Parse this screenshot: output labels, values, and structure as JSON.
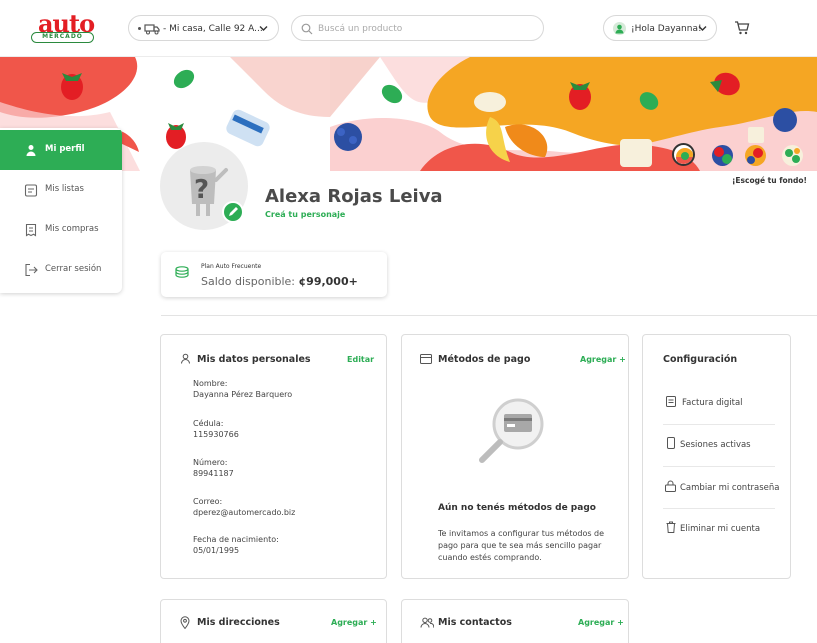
{
  "header": {
    "logo": {
      "top": "auto",
      "bottom": "MERCADO"
    },
    "address": "- Mi casa, Calle 92 A...",
    "search_placeholder": "Buscá un producto",
    "greeting": "¡Hola Dayanna!"
  },
  "sidebar": {
    "items": [
      {
        "label": "Mi perfil",
        "icon": "person-icon",
        "active": true
      },
      {
        "label": "Mis listas",
        "icon": "list-icon",
        "active": false
      },
      {
        "label": "Mis compras",
        "icon": "receipt-icon",
        "active": false
      },
      {
        "label": "Cerrar sesión",
        "icon": "logout-icon",
        "active": false
      }
    ]
  },
  "profile": {
    "name": "Alexa Rojas Leiva",
    "character_link": "Creá tu personaje",
    "background_pick": "¡Escogé tu fondo!"
  },
  "plan": {
    "title": "Plan Auto Frecuente",
    "balance_label": "Saldo disponible:",
    "balance_value": "¢99,000+"
  },
  "personal_data": {
    "title": "Mis datos personales",
    "edit": "Editar",
    "fields": [
      {
        "label": "Nombre:",
        "value": "Dayanna Pérez Barquero"
      },
      {
        "label": "Cédula:",
        "value": "115930766"
      },
      {
        "label": "Número:",
        "value": "89941187"
      },
      {
        "label": "Correo:",
        "value": "dperez@automercado.biz"
      },
      {
        "label": "Fecha de nacimiento:",
        "value": "05/01/1995"
      }
    ]
  },
  "payment": {
    "title": "Métodos de pago",
    "add": "Agregar +",
    "empty_title": "Aún no tenés métodos de pago",
    "empty_text": [
      "Te invitamos a configurar tus métodos de",
      "pago para que te sea más sencillo pagar",
      "cuando estés comprando."
    ]
  },
  "config": {
    "title": "Configuración",
    "items": [
      {
        "label": "Factura digital",
        "icon": "invoice-icon"
      },
      {
        "label": "Sesiones activas",
        "icon": "phone-icon"
      },
      {
        "label": "Cambiar mi contraseña",
        "icon": "lock-icon"
      },
      {
        "label": "Eliminar mi cuenta",
        "icon": "trash-icon"
      }
    ]
  },
  "addresses": {
    "title": "Mis direcciones",
    "add": "Agregar +"
  },
  "contacts": {
    "title": "Mis contactos",
    "add": "Agregar +"
  },
  "colors": {
    "brand_green": "#2dad55",
    "brand_red": "#e31e24",
    "banner_orange": "#f5a623",
    "banner_red": "#f0564a"
  }
}
